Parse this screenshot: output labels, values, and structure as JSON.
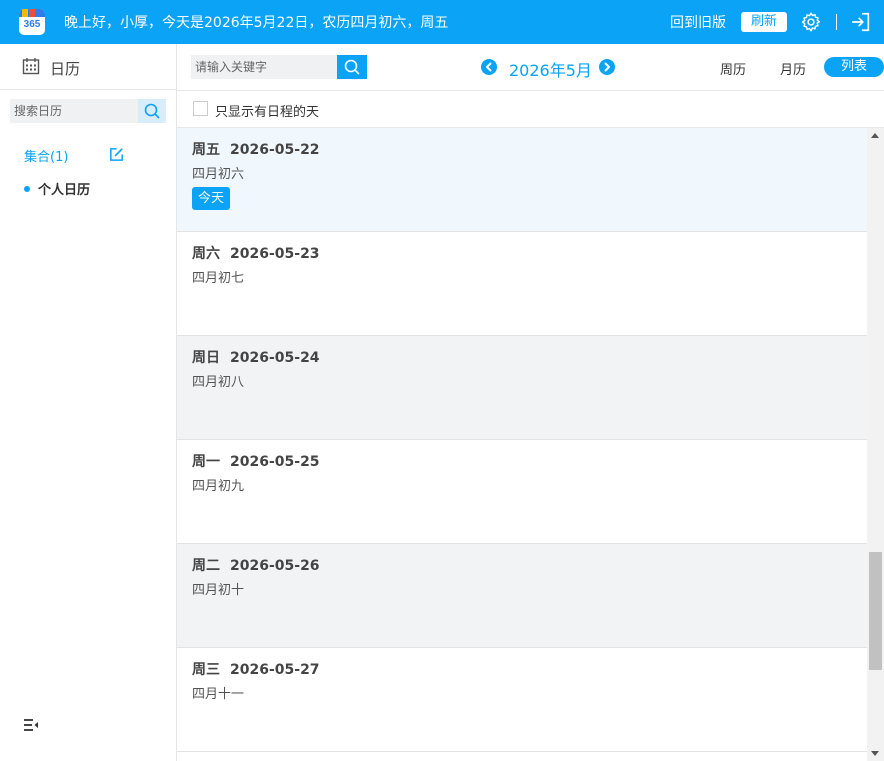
{
  "topbar": {
    "logo_text": "365",
    "greeting": "晚上好，小厚，今天是2026年5月22日，农历四月初六，周五",
    "old_version_label": "回到旧版",
    "refresh_label": "刷新",
    "settings_icon": "gear-icon",
    "exit_icon": "exit-icon"
  },
  "sidebar": {
    "title": "日历",
    "search_placeholder": "搜索日历",
    "collection_label": "集合(1)",
    "calendars": [
      {
        "name": "个人日历"
      }
    ]
  },
  "main": {
    "search_placeholder": "请输入关键字",
    "month_title": "2026年5月",
    "views": {
      "week": "周历",
      "month": "月历",
      "list": "列表",
      "active": "list"
    },
    "filter_label": "只显示有日程的天",
    "days": [
      {
        "weekday": "周五",
        "date": "2026-05-22",
        "lunar": "四月初六",
        "badge": "今天"
      },
      {
        "weekday": "周六",
        "date": "2026-05-23",
        "lunar": "四月初七"
      },
      {
        "weekday": "周日",
        "date": "2026-05-24",
        "lunar": "四月初八"
      },
      {
        "weekday": "周一",
        "date": "2026-05-25",
        "lunar": "四月初九"
      },
      {
        "weekday": "周二",
        "date": "2026-05-26",
        "lunar": "四月初十"
      },
      {
        "weekday": "周三",
        "date": "2026-05-27",
        "lunar": "四月十一"
      }
    ]
  },
  "colors": {
    "accent": "#0aa3f5",
    "today_row_bg": "#f0f8fe",
    "weekend_row_bg": "#f2f3f5",
    "weekday_row_bg": "#ffffff"
  }
}
